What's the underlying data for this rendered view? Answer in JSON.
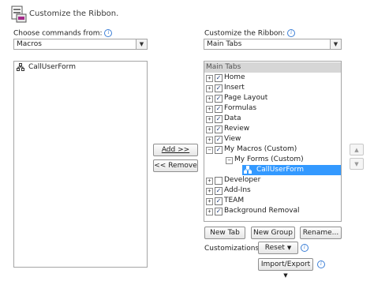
{
  "header": {
    "title": "Customize the Ribbon.",
    "icon": "customize-ribbon-icon"
  },
  "left": {
    "label": "Choose commands from:",
    "select_value": "Macros",
    "items": [
      "CallUserForm"
    ]
  },
  "right": {
    "label": "Customize the Ribbon:",
    "select_value": "Main Tabs",
    "tree_header": "Main Tabs",
    "tree": [
      {
        "label": "Home",
        "checked": true
      },
      {
        "label": "Insert",
        "checked": true
      },
      {
        "label": "Page Layout",
        "checked": true
      },
      {
        "label": "Formulas",
        "checked": true
      },
      {
        "label": "Data",
        "checked": true
      },
      {
        "label": "Review",
        "checked": true
      },
      {
        "label": "View",
        "checked": true
      },
      {
        "label": "My Macros (Custom)",
        "checked": true
      },
      {
        "label": "My Forms (Custom)"
      },
      {
        "label": "CallUserForm",
        "selected": true
      },
      {
        "label": "Developer",
        "checked": false
      },
      {
        "label": "Add-Ins",
        "checked": true
      },
      {
        "label": "TEAM",
        "checked": true
      },
      {
        "label": "Background Removal",
        "checked": true
      }
    ]
  },
  "buttons": {
    "add": "Add >>",
    "remove": "<< Remove",
    "new_tab": "New Tab",
    "new_group": "New Group",
    "rename": "Rename...",
    "reset": "Reset",
    "import_export": "Import/Export",
    "move_up": "▲",
    "move_down": "▼"
  },
  "customizations_label": "Customizations:",
  "colors": {
    "selection": "#3399ff",
    "info": "#3c7fd6"
  }
}
